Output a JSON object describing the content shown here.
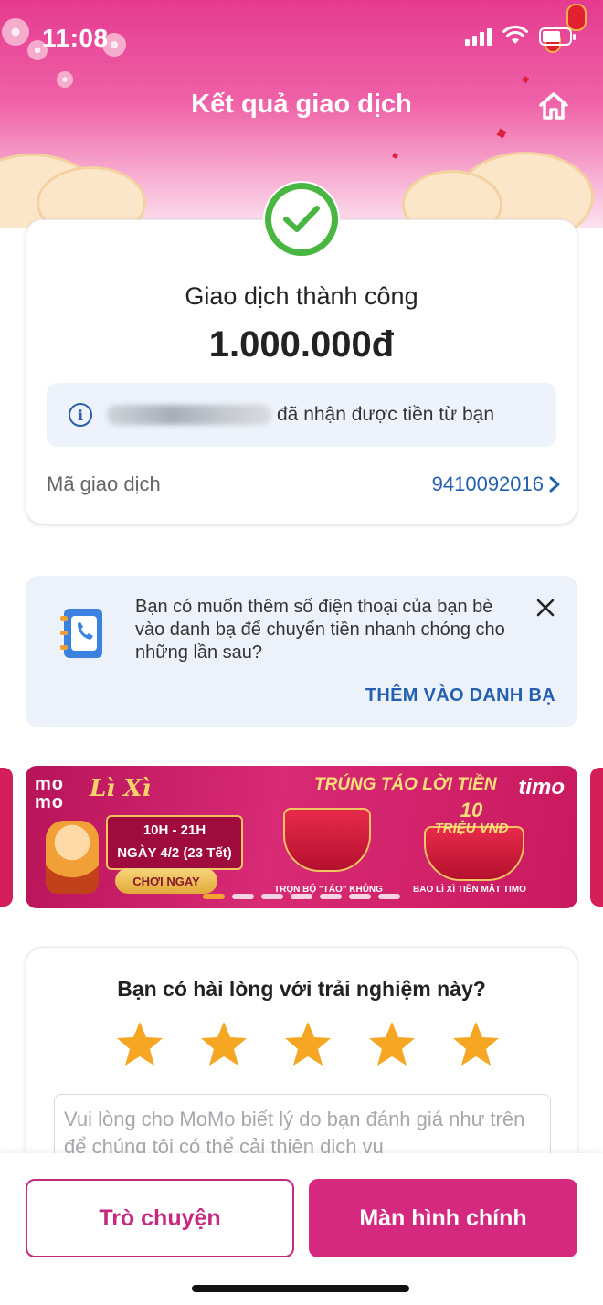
{
  "status_bar": {
    "time": "11:08"
  },
  "header": {
    "title": "Kết quả giao dịch"
  },
  "result": {
    "title": "Giao dịch thành công",
    "amount": "1.000.000đ",
    "info_suffix": "đã nhận được tiền từ bạn",
    "txn_label": "Mã giao dịch",
    "txn_id": "9410092016"
  },
  "contact_prompt": {
    "text": "Bạn có muốn thêm số điện thoại của bạn bè vào danh bạ để chuyển tiền nhanh chóng cho những lần sau?",
    "action": "THÊM VÀO DANH BẠ"
  },
  "banner": {
    "brand": "mo mo",
    "event_name": "Lì Xì",
    "time_range": "10H - 21H",
    "date": "NGÀY 4/2 (23 Tết)",
    "play_label": "CHƠI NGAY",
    "headline": "TRÚNG TÁO LỜI TIỀN",
    "partner": "timo",
    "prize_number": "10",
    "prize_unit": "TRIỆU VNĐ",
    "caption_1": "TRỌN BỘ \"TÁO\" KHỦNG",
    "caption_2": "BAO LÌ XÌ TIỀN MẶT TIMO",
    "slide_count": 7,
    "active_slide": 1
  },
  "rating": {
    "title": "Bạn có hài lòng với trải nghiệm này?",
    "stars_total": 5,
    "stars_selected": 5,
    "feedback_placeholder": "Vui lòng cho MoMo biết lý do bạn đánh giá như trên để chúng tôi có thể cải thiện dịch vụ"
  },
  "actions": {
    "chat_label": "Trò chuyện",
    "home_label": "Màn hình chính"
  },
  "colors": {
    "brand_pink": "#d5297f",
    "success_green": "#49b642",
    "link_blue": "#2460b0",
    "star_orange": "#f5a623"
  }
}
